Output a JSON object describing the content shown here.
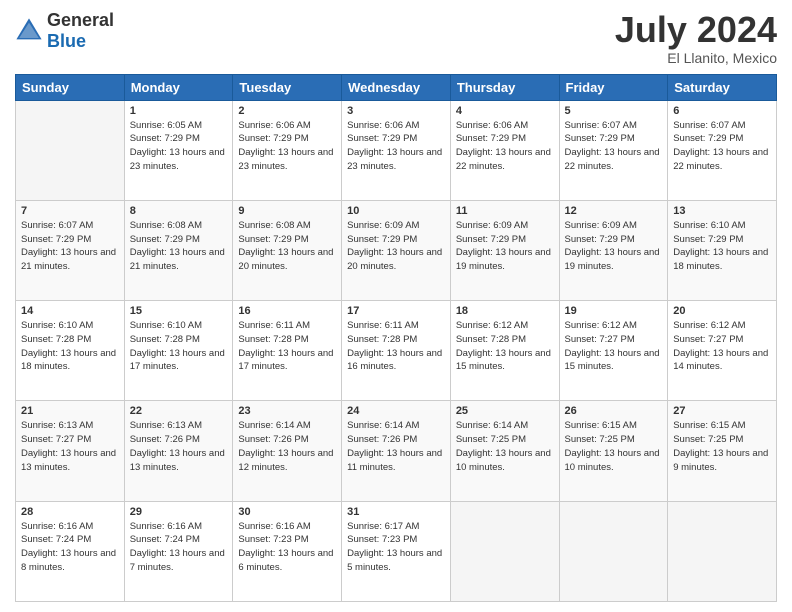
{
  "header": {
    "logo": {
      "general": "General",
      "blue": "Blue"
    },
    "title": "July 2024",
    "location": "El Llanito, Mexico"
  },
  "days_of_week": [
    "Sunday",
    "Monday",
    "Tuesday",
    "Wednesday",
    "Thursday",
    "Friday",
    "Saturday"
  ],
  "weeks": [
    [
      {
        "day": "",
        "sunrise": "",
        "sunset": "",
        "daylight": ""
      },
      {
        "day": "1",
        "sunrise": "Sunrise: 6:05 AM",
        "sunset": "Sunset: 7:29 PM",
        "daylight": "Daylight: 13 hours and 23 minutes."
      },
      {
        "day": "2",
        "sunrise": "Sunrise: 6:06 AM",
        "sunset": "Sunset: 7:29 PM",
        "daylight": "Daylight: 13 hours and 23 minutes."
      },
      {
        "day": "3",
        "sunrise": "Sunrise: 6:06 AM",
        "sunset": "Sunset: 7:29 PM",
        "daylight": "Daylight: 13 hours and 23 minutes."
      },
      {
        "day": "4",
        "sunrise": "Sunrise: 6:06 AM",
        "sunset": "Sunset: 7:29 PM",
        "daylight": "Daylight: 13 hours and 22 minutes."
      },
      {
        "day": "5",
        "sunrise": "Sunrise: 6:07 AM",
        "sunset": "Sunset: 7:29 PM",
        "daylight": "Daylight: 13 hours and 22 minutes."
      },
      {
        "day": "6",
        "sunrise": "Sunrise: 6:07 AM",
        "sunset": "Sunset: 7:29 PM",
        "daylight": "Daylight: 13 hours and 22 minutes."
      }
    ],
    [
      {
        "day": "7",
        "sunrise": "Sunrise: 6:07 AM",
        "sunset": "Sunset: 7:29 PM",
        "daylight": "Daylight: 13 hours and 21 minutes."
      },
      {
        "day": "8",
        "sunrise": "Sunrise: 6:08 AM",
        "sunset": "Sunset: 7:29 PM",
        "daylight": "Daylight: 13 hours and 21 minutes."
      },
      {
        "day": "9",
        "sunrise": "Sunrise: 6:08 AM",
        "sunset": "Sunset: 7:29 PM",
        "daylight": "Daylight: 13 hours and 20 minutes."
      },
      {
        "day": "10",
        "sunrise": "Sunrise: 6:09 AM",
        "sunset": "Sunset: 7:29 PM",
        "daylight": "Daylight: 13 hours and 20 minutes."
      },
      {
        "day": "11",
        "sunrise": "Sunrise: 6:09 AM",
        "sunset": "Sunset: 7:29 PM",
        "daylight": "Daylight: 13 hours and 19 minutes."
      },
      {
        "day": "12",
        "sunrise": "Sunrise: 6:09 AM",
        "sunset": "Sunset: 7:29 PM",
        "daylight": "Daylight: 13 hours and 19 minutes."
      },
      {
        "day": "13",
        "sunrise": "Sunrise: 6:10 AM",
        "sunset": "Sunset: 7:29 PM",
        "daylight": "Daylight: 13 hours and 18 minutes."
      }
    ],
    [
      {
        "day": "14",
        "sunrise": "Sunrise: 6:10 AM",
        "sunset": "Sunset: 7:28 PM",
        "daylight": "Daylight: 13 hours and 18 minutes."
      },
      {
        "day": "15",
        "sunrise": "Sunrise: 6:10 AM",
        "sunset": "Sunset: 7:28 PM",
        "daylight": "Daylight: 13 hours and 17 minutes."
      },
      {
        "day": "16",
        "sunrise": "Sunrise: 6:11 AM",
        "sunset": "Sunset: 7:28 PM",
        "daylight": "Daylight: 13 hours and 17 minutes."
      },
      {
        "day": "17",
        "sunrise": "Sunrise: 6:11 AM",
        "sunset": "Sunset: 7:28 PM",
        "daylight": "Daylight: 13 hours and 16 minutes."
      },
      {
        "day": "18",
        "sunrise": "Sunrise: 6:12 AM",
        "sunset": "Sunset: 7:28 PM",
        "daylight": "Daylight: 13 hours and 15 minutes."
      },
      {
        "day": "19",
        "sunrise": "Sunrise: 6:12 AM",
        "sunset": "Sunset: 7:27 PM",
        "daylight": "Daylight: 13 hours and 15 minutes."
      },
      {
        "day": "20",
        "sunrise": "Sunrise: 6:12 AM",
        "sunset": "Sunset: 7:27 PM",
        "daylight": "Daylight: 13 hours and 14 minutes."
      }
    ],
    [
      {
        "day": "21",
        "sunrise": "Sunrise: 6:13 AM",
        "sunset": "Sunset: 7:27 PM",
        "daylight": "Daylight: 13 hours and 13 minutes."
      },
      {
        "day": "22",
        "sunrise": "Sunrise: 6:13 AM",
        "sunset": "Sunset: 7:26 PM",
        "daylight": "Daylight: 13 hours and 13 minutes."
      },
      {
        "day": "23",
        "sunrise": "Sunrise: 6:14 AM",
        "sunset": "Sunset: 7:26 PM",
        "daylight": "Daylight: 13 hours and 12 minutes."
      },
      {
        "day": "24",
        "sunrise": "Sunrise: 6:14 AM",
        "sunset": "Sunset: 7:26 PM",
        "daylight": "Daylight: 13 hours and 11 minutes."
      },
      {
        "day": "25",
        "sunrise": "Sunrise: 6:14 AM",
        "sunset": "Sunset: 7:25 PM",
        "daylight": "Daylight: 13 hours and 10 minutes."
      },
      {
        "day": "26",
        "sunrise": "Sunrise: 6:15 AM",
        "sunset": "Sunset: 7:25 PM",
        "daylight": "Daylight: 13 hours and 10 minutes."
      },
      {
        "day": "27",
        "sunrise": "Sunrise: 6:15 AM",
        "sunset": "Sunset: 7:25 PM",
        "daylight": "Daylight: 13 hours and 9 minutes."
      }
    ],
    [
      {
        "day": "28",
        "sunrise": "Sunrise: 6:16 AM",
        "sunset": "Sunset: 7:24 PM",
        "daylight": "Daylight: 13 hours and 8 minutes."
      },
      {
        "day": "29",
        "sunrise": "Sunrise: 6:16 AM",
        "sunset": "Sunset: 7:24 PM",
        "daylight": "Daylight: 13 hours and 7 minutes."
      },
      {
        "day": "30",
        "sunrise": "Sunrise: 6:16 AM",
        "sunset": "Sunset: 7:23 PM",
        "daylight": "Daylight: 13 hours and 6 minutes."
      },
      {
        "day": "31",
        "sunrise": "Sunrise: 6:17 AM",
        "sunset": "Sunset: 7:23 PM",
        "daylight": "Daylight: 13 hours and 5 minutes."
      },
      {
        "day": "",
        "sunrise": "",
        "sunset": "",
        "daylight": ""
      },
      {
        "day": "",
        "sunrise": "",
        "sunset": "",
        "daylight": ""
      },
      {
        "day": "",
        "sunrise": "",
        "sunset": "",
        "daylight": ""
      }
    ]
  ]
}
